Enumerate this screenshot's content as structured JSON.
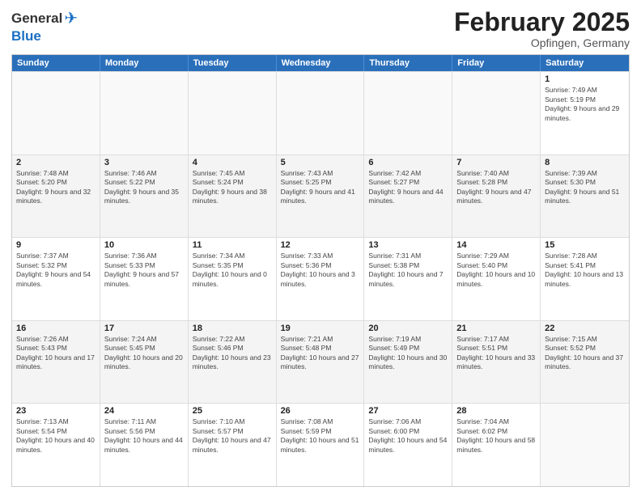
{
  "header": {
    "logo_general": "General",
    "logo_blue": "Blue",
    "month_title": "February 2025",
    "location": "Opfingen, Germany"
  },
  "calendar": {
    "days_of_week": [
      "Sunday",
      "Monday",
      "Tuesday",
      "Wednesday",
      "Thursday",
      "Friday",
      "Saturday"
    ],
    "rows": [
      {
        "alt": false,
        "cells": [
          {
            "day": "",
            "info": ""
          },
          {
            "day": "",
            "info": ""
          },
          {
            "day": "",
            "info": ""
          },
          {
            "day": "",
            "info": ""
          },
          {
            "day": "",
            "info": ""
          },
          {
            "day": "",
            "info": ""
          },
          {
            "day": "1",
            "info": "Sunrise: 7:49 AM\nSunset: 5:19 PM\nDaylight: 9 hours and 29 minutes."
          }
        ]
      },
      {
        "alt": true,
        "cells": [
          {
            "day": "2",
            "info": "Sunrise: 7:48 AM\nSunset: 5:20 PM\nDaylight: 9 hours and 32 minutes."
          },
          {
            "day": "3",
            "info": "Sunrise: 7:46 AM\nSunset: 5:22 PM\nDaylight: 9 hours and 35 minutes."
          },
          {
            "day": "4",
            "info": "Sunrise: 7:45 AM\nSunset: 5:24 PM\nDaylight: 9 hours and 38 minutes."
          },
          {
            "day": "5",
            "info": "Sunrise: 7:43 AM\nSunset: 5:25 PM\nDaylight: 9 hours and 41 minutes."
          },
          {
            "day": "6",
            "info": "Sunrise: 7:42 AM\nSunset: 5:27 PM\nDaylight: 9 hours and 44 minutes."
          },
          {
            "day": "7",
            "info": "Sunrise: 7:40 AM\nSunset: 5:28 PM\nDaylight: 9 hours and 47 minutes."
          },
          {
            "day": "8",
            "info": "Sunrise: 7:39 AM\nSunset: 5:30 PM\nDaylight: 9 hours and 51 minutes."
          }
        ]
      },
      {
        "alt": false,
        "cells": [
          {
            "day": "9",
            "info": "Sunrise: 7:37 AM\nSunset: 5:32 PM\nDaylight: 9 hours and 54 minutes."
          },
          {
            "day": "10",
            "info": "Sunrise: 7:36 AM\nSunset: 5:33 PM\nDaylight: 9 hours and 57 minutes."
          },
          {
            "day": "11",
            "info": "Sunrise: 7:34 AM\nSunset: 5:35 PM\nDaylight: 10 hours and 0 minutes."
          },
          {
            "day": "12",
            "info": "Sunrise: 7:33 AM\nSunset: 5:36 PM\nDaylight: 10 hours and 3 minutes."
          },
          {
            "day": "13",
            "info": "Sunrise: 7:31 AM\nSunset: 5:38 PM\nDaylight: 10 hours and 7 minutes."
          },
          {
            "day": "14",
            "info": "Sunrise: 7:29 AM\nSunset: 5:40 PM\nDaylight: 10 hours and 10 minutes."
          },
          {
            "day": "15",
            "info": "Sunrise: 7:28 AM\nSunset: 5:41 PM\nDaylight: 10 hours and 13 minutes."
          }
        ]
      },
      {
        "alt": true,
        "cells": [
          {
            "day": "16",
            "info": "Sunrise: 7:26 AM\nSunset: 5:43 PM\nDaylight: 10 hours and 17 minutes."
          },
          {
            "day": "17",
            "info": "Sunrise: 7:24 AM\nSunset: 5:45 PM\nDaylight: 10 hours and 20 minutes."
          },
          {
            "day": "18",
            "info": "Sunrise: 7:22 AM\nSunset: 5:46 PM\nDaylight: 10 hours and 23 minutes."
          },
          {
            "day": "19",
            "info": "Sunrise: 7:21 AM\nSunset: 5:48 PM\nDaylight: 10 hours and 27 minutes."
          },
          {
            "day": "20",
            "info": "Sunrise: 7:19 AM\nSunset: 5:49 PM\nDaylight: 10 hours and 30 minutes."
          },
          {
            "day": "21",
            "info": "Sunrise: 7:17 AM\nSunset: 5:51 PM\nDaylight: 10 hours and 33 minutes."
          },
          {
            "day": "22",
            "info": "Sunrise: 7:15 AM\nSunset: 5:52 PM\nDaylight: 10 hours and 37 minutes."
          }
        ]
      },
      {
        "alt": false,
        "cells": [
          {
            "day": "23",
            "info": "Sunrise: 7:13 AM\nSunset: 5:54 PM\nDaylight: 10 hours and 40 minutes."
          },
          {
            "day": "24",
            "info": "Sunrise: 7:11 AM\nSunset: 5:56 PM\nDaylight: 10 hours and 44 minutes."
          },
          {
            "day": "25",
            "info": "Sunrise: 7:10 AM\nSunset: 5:57 PM\nDaylight: 10 hours and 47 minutes."
          },
          {
            "day": "26",
            "info": "Sunrise: 7:08 AM\nSunset: 5:59 PM\nDaylight: 10 hours and 51 minutes."
          },
          {
            "day": "27",
            "info": "Sunrise: 7:06 AM\nSunset: 6:00 PM\nDaylight: 10 hours and 54 minutes."
          },
          {
            "day": "28",
            "info": "Sunrise: 7:04 AM\nSunset: 6:02 PM\nDaylight: 10 hours and 58 minutes."
          },
          {
            "day": "",
            "info": ""
          }
        ]
      }
    ]
  }
}
